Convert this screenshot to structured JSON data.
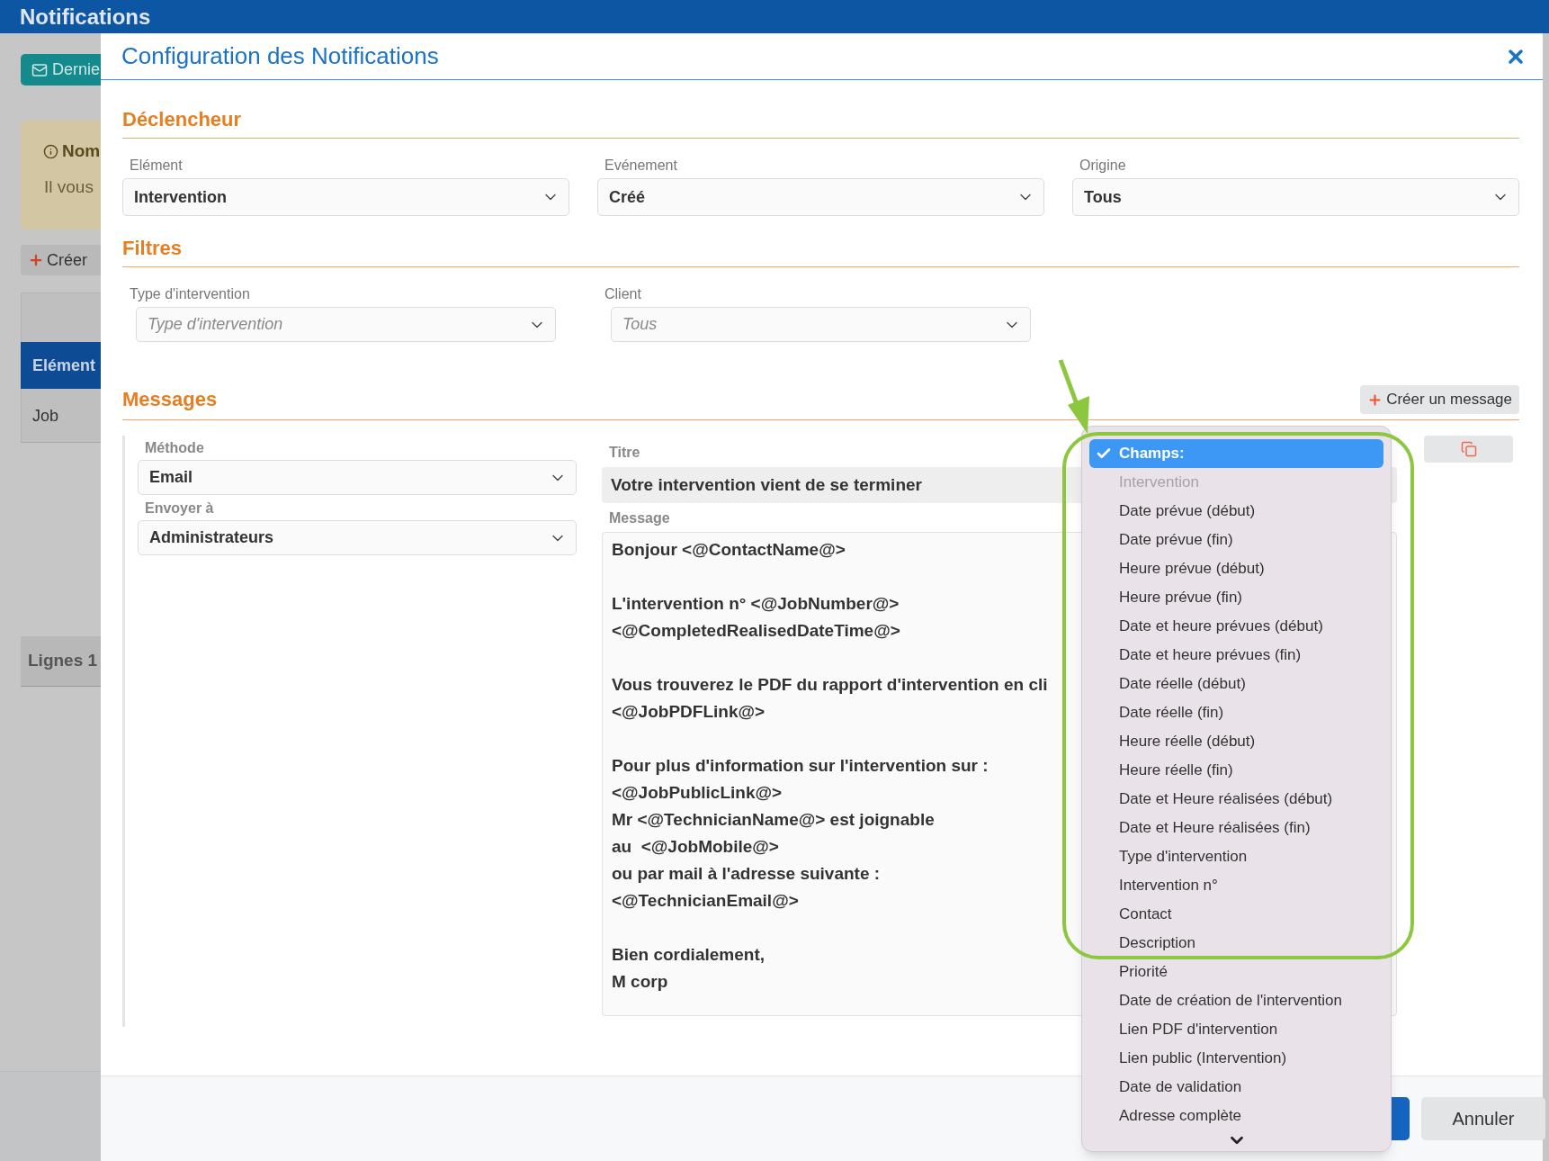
{
  "app_header": {
    "title": "Notifications"
  },
  "background": {
    "last_button": "Dernie",
    "notice_title": "Nom",
    "notice_text": "Il vous",
    "create_button": "Créer",
    "table_header": "Elément",
    "table_rows": [
      "Job"
    ],
    "lines_label": "Lignes 1"
  },
  "dialog": {
    "title": "Configuration des Notifications",
    "trigger": {
      "heading": "Déclencheur",
      "fields": [
        {
          "label": "Elément",
          "value": "Intervention"
        },
        {
          "label": "Evénement",
          "value": "Créé"
        },
        {
          "label": "Origine",
          "value": "Tous"
        }
      ]
    },
    "filters": {
      "heading": "Filtres",
      "fields": [
        {
          "label": "Type d'intervention",
          "placeholder": "Type d'intervention"
        },
        {
          "label": "Client",
          "placeholder": "Tous"
        }
      ]
    },
    "messages": {
      "heading": "Messages",
      "create_button": "Créer un message",
      "method": {
        "label": "Méthode",
        "value": "Email"
      },
      "send_to": {
        "label": "Envoyer à",
        "value": "Administrateurs"
      },
      "title_label": "Titre",
      "title_value": "Votre intervention vient de se terminer",
      "message_label": "Message",
      "message_paragraphs": [
        [
          "Bonjour <@ContactName@>"
        ],
        [
          "L'intervention n° <@JobNumber@>",
          "<@CompletedRealisedDateTime@>"
        ],
        [
          "Vous trouverez le PDF du rapport d'intervention en cli",
          "<@JobPDFLink@>"
        ],
        [
          "Pour plus d'information sur l'intervention sur :",
          "<@JobPublicLink@>",
          "Mr <@TechnicianName@> est joignable",
          "au  <@JobMobile@>",
          "ou par mail à l'adresse suivante :",
          "<@TechnicianEmail@>"
        ],
        [
          "Bien cordialement,",
          "M corp"
        ]
      ]
    },
    "footer": {
      "cancel_button": "Annuler"
    }
  },
  "fields_menu": {
    "items": [
      {
        "label": "Champs:",
        "selected": true,
        "disabled": false
      },
      {
        "label": "Intervention",
        "selected": false,
        "disabled": true
      },
      {
        "label": "Date prévue (début)",
        "selected": false,
        "disabled": false
      },
      {
        "label": "Date prévue (fin)",
        "selected": false,
        "disabled": false
      },
      {
        "label": "Heure prévue (début)",
        "selected": false,
        "disabled": false
      },
      {
        "label": "Heure prévue (fin)",
        "selected": false,
        "disabled": false
      },
      {
        "label": "Date et heure prévues (début)",
        "selected": false,
        "disabled": false
      },
      {
        "label": "Date et heure prévues (fin)",
        "selected": false,
        "disabled": false
      },
      {
        "label": "Date réelle (début)",
        "selected": false,
        "disabled": false
      },
      {
        "label": "Date réelle (fin)",
        "selected": false,
        "disabled": false
      },
      {
        "label": "Heure réelle (début)",
        "selected": false,
        "disabled": false
      },
      {
        "label": "Heure réelle (fin)",
        "selected": false,
        "disabled": false
      },
      {
        "label": "Date et Heure réalisées (début)",
        "selected": false,
        "disabled": false
      },
      {
        "label": "Date et Heure réalisées (fin)",
        "selected": false,
        "disabled": false
      },
      {
        "label": "Type d'intervention",
        "selected": false,
        "disabled": false
      },
      {
        "label": "Intervention n°",
        "selected": false,
        "disabled": false
      },
      {
        "label": "Contact",
        "selected": false,
        "disabled": false
      },
      {
        "label": "Description",
        "selected": false,
        "disabled": false
      },
      {
        "label": "Priorité",
        "selected": false,
        "disabled": false
      },
      {
        "label": "Date de création de l'intervention",
        "selected": false,
        "disabled": false
      },
      {
        "label": "Lien PDF d'intervention",
        "selected": false,
        "disabled": false
      },
      {
        "label": "Lien public (Intervention)",
        "selected": false,
        "disabled": false
      },
      {
        "label": "Date de validation",
        "selected": false,
        "disabled": false
      },
      {
        "label": "Adresse complète",
        "selected": false,
        "disabled": false
      }
    ]
  }
}
